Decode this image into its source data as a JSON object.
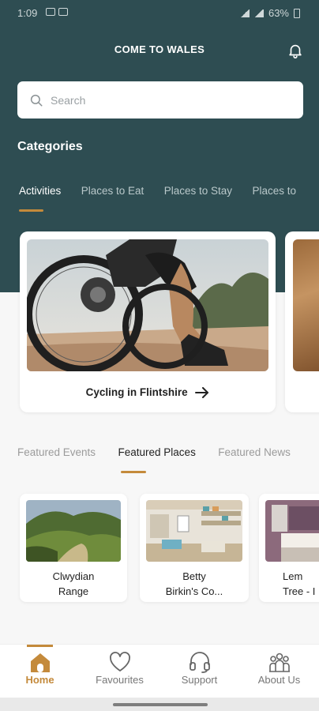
{
  "status_bar": {
    "time": "1:09",
    "battery": "63%"
  },
  "header": {
    "title": "COME TO WALES"
  },
  "search": {
    "placeholder": "Search"
  },
  "categories": {
    "title": "Categories",
    "tabs": [
      "Activities",
      "Places to Eat",
      "Places to Stay",
      "Places to"
    ],
    "active_index": 0
  },
  "activity_card": {
    "label": "Cycling in Flintshire"
  },
  "featured": {
    "tabs": [
      "Featured Events",
      "Featured Places",
      "Featured News"
    ],
    "active_index": 1,
    "places": [
      {
        "name_line1": "Clwydian",
        "name_line2": "Range"
      },
      {
        "name_line1": "Betty",
        "name_line2": "Birkin's Co..."
      },
      {
        "name_line1": "Lem",
        "name_line2": "Tree - I"
      }
    ]
  },
  "bottom_nav": {
    "items": [
      {
        "label": "Home",
        "icon": "home-icon"
      },
      {
        "label": "Favourites",
        "icon": "heart-icon"
      },
      {
        "label": "Support",
        "icon": "headset-icon"
      },
      {
        "label": "About Us",
        "icon": "people-icon"
      }
    ],
    "active_index": 0
  },
  "colors": {
    "header_bg": "#2e4d52",
    "accent": "#c48a3b"
  }
}
